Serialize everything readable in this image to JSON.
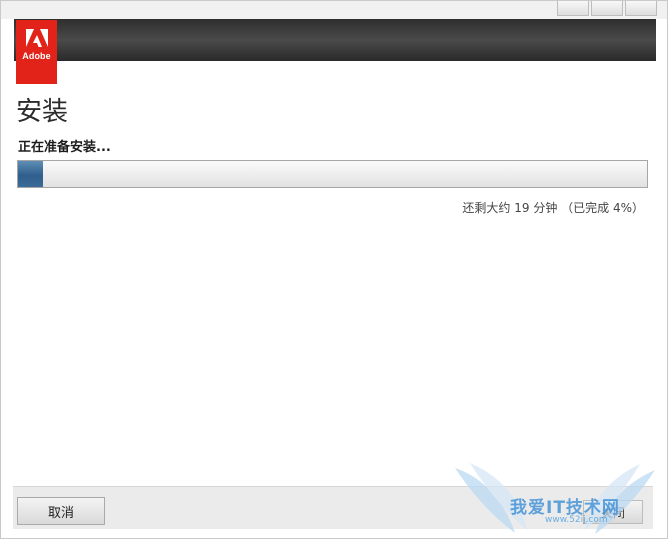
{
  "window": {
    "buttons": [
      "minimize",
      "maximize",
      "close"
    ]
  },
  "brand": {
    "logo_text": "Adobe",
    "color": "#e2231a"
  },
  "page": {
    "title": "安装",
    "status": "正在准备安装..."
  },
  "progress": {
    "percent": 4,
    "time_remaining": "还剩大约 19 分钟 （已完成 4%）",
    "fill_color": "#2f5f8d"
  },
  "footer": {
    "cancel_label": "取消",
    "close_label": "关闭"
  },
  "watermark": {
    "brand": "我爱IT技术网",
    "url": "www.52ij.com"
  }
}
